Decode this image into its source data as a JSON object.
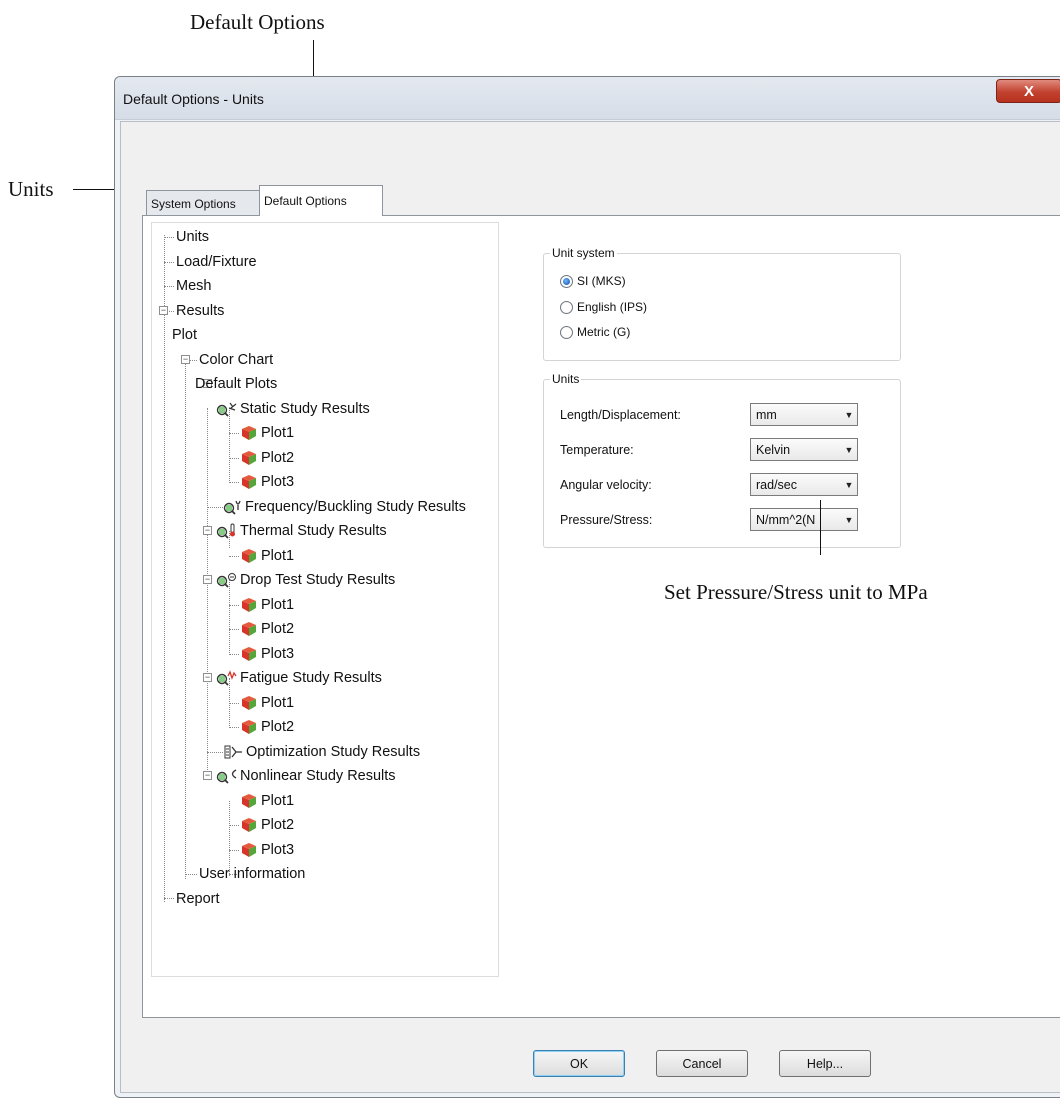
{
  "annotations": {
    "default_options": "Default Options",
    "units": "Units",
    "pressure_note": "Set Pressure/Stress unit to MPa"
  },
  "window": {
    "title": "Default Options - Units",
    "close_glyph": "X"
  },
  "tabs": [
    {
      "label": "System Options",
      "active": false
    },
    {
      "label": "Default Options",
      "active": true
    }
  ],
  "tree": {
    "units": "Units",
    "load_fixture": "Load/Fixture",
    "mesh": "Mesh",
    "results": "Results",
    "plot": "Plot",
    "color_chart": "Color Chart",
    "default_plots": "Default Plots",
    "static": "Static Study Results",
    "frequency": "Frequency/Buckling Study Results",
    "thermal": "Thermal Study Results",
    "drop": "Drop Test Study Results",
    "fatigue": "Fatigue Study Results",
    "optimization": "Optimization Study Results",
    "nonlinear": "Nonlinear Study Results",
    "plot1": "Plot1",
    "plot2": "Plot2",
    "plot3": "Plot3",
    "user_information": "User information",
    "report": "Report",
    "expand_glyph": "−"
  },
  "unit_system": {
    "title": "Unit system",
    "options": [
      {
        "label": "SI (MKS)",
        "selected": true
      },
      {
        "label": "English (IPS)",
        "selected": false
      },
      {
        "label": "Metric (G)",
        "selected": false
      }
    ]
  },
  "units": {
    "title": "Units",
    "fields": [
      {
        "label": "Length/Displacement:",
        "value": "mm"
      },
      {
        "label": "Temperature:",
        "value": "Kelvin"
      },
      {
        "label": "Angular velocity:",
        "value": "rad/sec"
      },
      {
        "label": "Pressure/Stress:",
        "value": "N/mm^2(N"
      }
    ],
    "dropdown_glyph": "▼"
  },
  "buttons": {
    "ok": "OK",
    "cancel": "Cancel",
    "help": "Help..."
  },
  "colors": {
    "close_button": "#c2412f",
    "radio_selected": "#0a4aa3",
    "cube_red": "#d8342a",
    "cube_green": "#55a63a",
    "cube_yellow": "#e8b830"
  }
}
